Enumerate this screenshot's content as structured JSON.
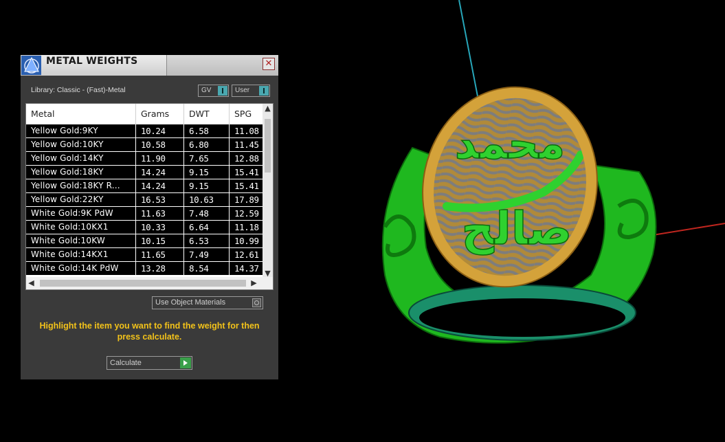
{
  "panel": {
    "title": "METAL WEIGHTS",
    "close_glyph": "✕",
    "library_label": "Library: Classic - (Fast)-Metal",
    "gv_label": "GV",
    "user_label": "User",
    "columns": [
      "Metal",
      "Grams",
      "DWT",
      "SPG"
    ],
    "rows": [
      {
        "metal": "Yellow Gold:9KY",
        "grams": "10.24",
        "dwt": "6.58",
        "spg": "11.08"
      },
      {
        "metal": "Yellow Gold:10KY",
        "grams": "10.58",
        "dwt": "6.80",
        "spg": "11.45"
      },
      {
        "metal": "Yellow Gold:14KY",
        "grams": "11.90",
        "dwt": "7.65",
        "spg": "12.88"
      },
      {
        "metal": "Yellow Gold:18KY",
        "grams": "14.24",
        "dwt": "9.15",
        "spg": "15.41"
      },
      {
        "metal": "Yellow Gold:18KY R...",
        "grams": "14.24",
        "dwt": "9.15",
        "spg": "15.41"
      },
      {
        "metal": "Yellow Gold:22KY",
        "grams": "16.53",
        "dwt": "10.63",
        "spg": "17.89"
      },
      {
        "metal": "White Gold:9K PdW",
        "grams": "11.63",
        "dwt": "7.48",
        "spg": "12.59"
      },
      {
        "metal": "White Gold:10KX1",
        "grams": "10.33",
        "dwt": "6.64",
        "spg": "11.18"
      },
      {
        "metal": "White Gold:10KW",
        "grams": "10.15",
        "dwt": "6.53",
        "spg": "10.99"
      },
      {
        "metal": "White Gold:14KX1",
        "grams": "11.65",
        "dwt": "7.49",
        "spg": "12.61"
      },
      {
        "metal": "White Gold:14K PdW",
        "grams": "13.28",
        "dwt": "8.54",
        "spg": "14.37"
      }
    ],
    "use_object_materials_label": "Use Object Materials",
    "instructions": "Highlight the item you want to find the weight for then press calculate.",
    "calculate_label": "Calculate"
  },
  "viewport": {
    "engraving_line1": "محمد",
    "engraving_line2": "صالح",
    "colors": {
      "ring_green": "#2fd12f",
      "bezel_gold": "#d4a23a",
      "waves": "#8a8a8a",
      "axis_cyan": "#27a6b9",
      "axis_red": "#c0261f"
    }
  },
  "icons": {
    "logo": "app-logo-icon",
    "close": "close-icon",
    "scroll_up": "chevron-up-icon",
    "scroll_down": "chevron-down-icon",
    "scroll_left": "chevron-left-icon",
    "scroll_right": "chevron-right-icon",
    "calculate": "play-icon"
  }
}
